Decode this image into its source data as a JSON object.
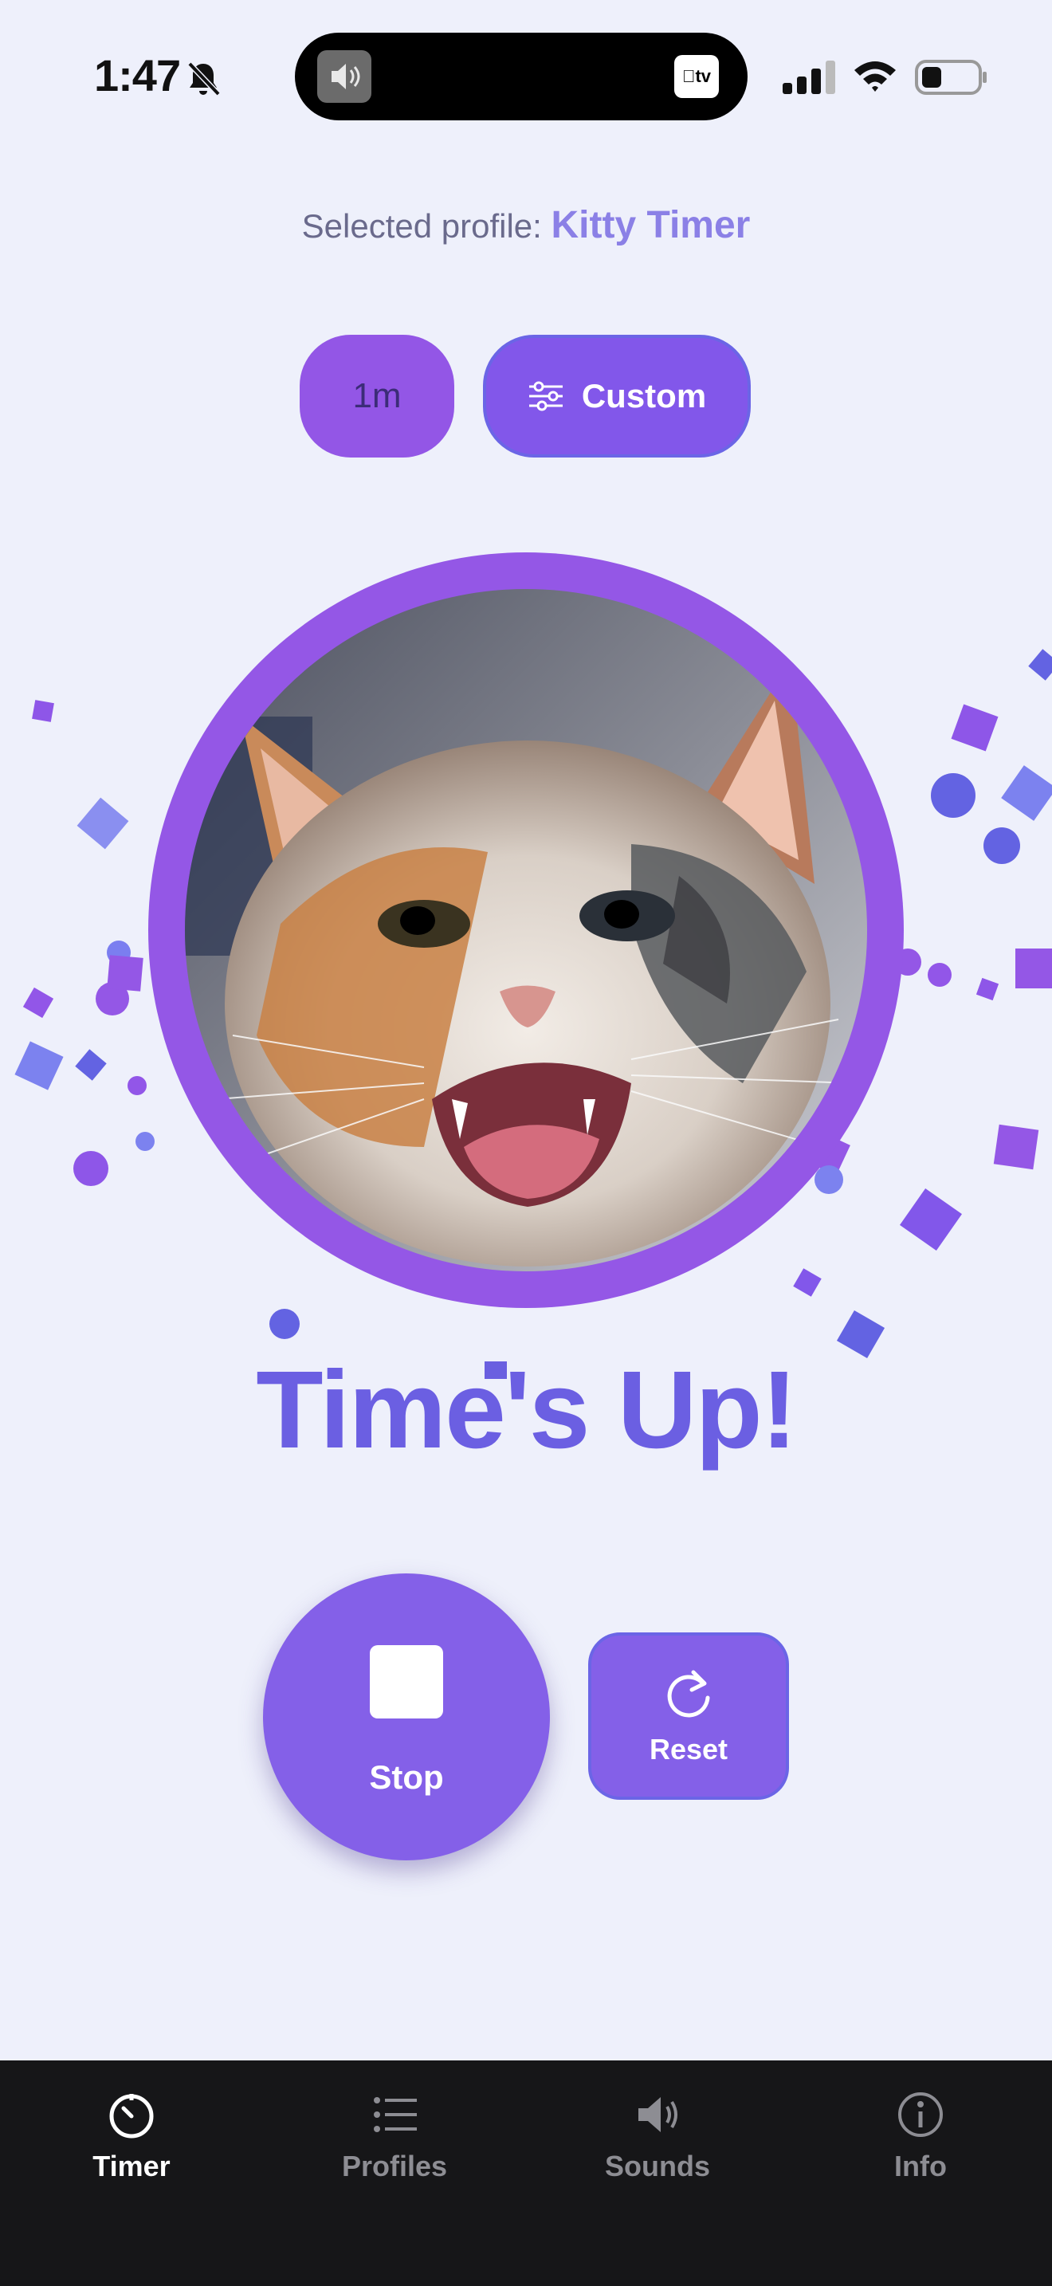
{
  "status_bar": {
    "time": "1:47",
    "tv_label": "tv"
  },
  "profile": {
    "prefix": "Selected profile:",
    "name": "Kitty Timer"
  },
  "duration_button": {
    "label": "1m"
  },
  "custom_button": {
    "label": "Custom"
  },
  "result": {
    "title": "Time's Up!"
  },
  "controls": {
    "stop_label": "Stop",
    "reset_label": "Reset"
  },
  "tabs": [
    {
      "label": "Timer",
      "icon": "timer-icon",
      "active": true
    },
    {
      "label": "Profiles",
      "icon": "list-icon",
      "active": false
    },
    {
      "label": "Sounds",
      "icon": "speaker-icon",
      "active": false
    },
    {
      "label": "Info",
      "icon": "info-icon",
      "active": false
    }
  ],
  "colors": {
    "accent": "#8460e8",
    "title": "#6b5fe2",
    "background": "#eef0fb",
    "tabbar": "#161618"
  }
}
